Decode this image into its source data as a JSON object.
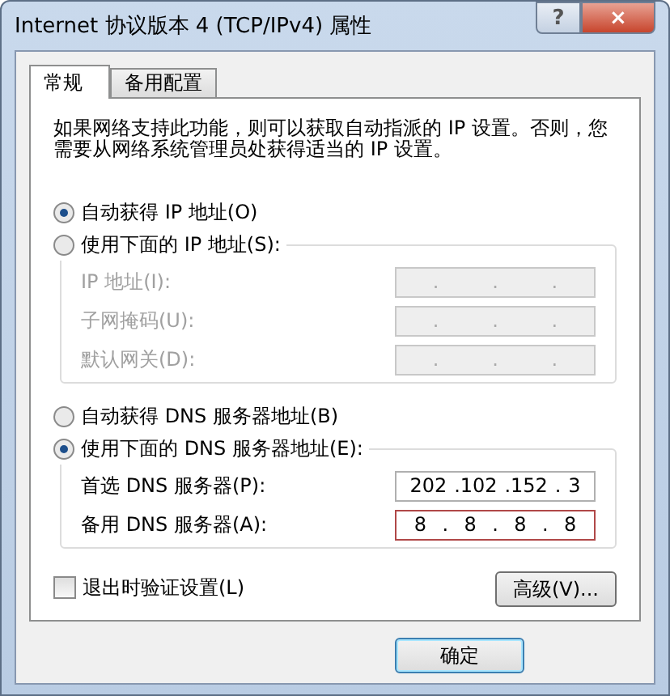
{
  "window": {
    "title": "Internet 协议版本 4 (TCP/IPv4) 属性",
    "help_button": "?",
    "close_button": "×"
  },
  "tabs": [
    {
      "label": "常规",
      "selected": true
    },
    {
      "label": "备用配置",
      "selected": false
    }
  ],
  "intro": "如果网络支持此功能，则可以获取自动指派的 IP 设置。否则，您需要从网络系统管理员处获得适当的 IP 设置。",
  "ip_mode": [
    {
      "label": "自动获得 IP 地址(O)",
      "selected": true
    },
    {
      "label": "使用下面的 IP 地址(S):",
      "selected": false
    }
  ],
  "ip_fields": [
    {
      "label": "IP 地址(I):",
      "disabled": true,
      "highlighted": false,
      "parts": [
        ".",
        ".",
        "."
      ]
    },
    {
      "label": "子网掩码(U):",
      "disabled": true,
      "highlighted": false,
      "parts": [
        ".",
        ".",
        "."
      ]
    },
    {
      "label": "默认网关(D):",
      "disabled": true,
      "highlighted": false,
      "parts": [
        ".",
        ".",
        "."
      ]
    }
  ],
  "dns_mode": [
    {
      "label": "自动获得 DNS 服务器地址(B)",
      "selected": false
    },
    {
      "label": "使用下面的 DNS 服务器地址(E):",
      "selected": true
    }
  ],
  "dns_fields": [
    {
      "label": "首选 DNS 服务器(P):",
      "disabled": false,
      "highlighted": false,
      "parts": [
        "202",
        ".102",
        ".152",
        ".",
        "3"
      ]
    },
    {
      "label": "备用 DNS 服务器(A):",
      "disabled": false,
      "highlighted": true,
      "parts": [
        "8",
        ".",
        "8",
        ".",
        "8",
        ".",
        "8"
      ]
    }
  ],
  "validate": {
    "label": "退出时验证设置(L)",
    "checked": false
  },
  "advanced_button": "高级(V)...",
  "ok_button": "确定"
}
